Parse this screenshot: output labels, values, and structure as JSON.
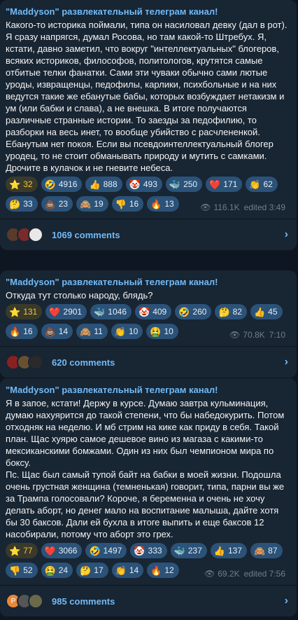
{
  "posts": [
    {
      "channel": "\"Maddyson\" развлекательный телеграм канал!",
      "text": "Какого-то историка поймали, типа он насиловал девку (дал в рот). Я сразу напрягся, думал Росова, но там какой-то Штребух. Я, кстати, давно заметил, что вокруг \"интеллектуальных\" блогеров, всяких историков, философов, политологов, крутятся самые отбитые телки фанатки. Сами эти чуваки обычно сами лютые уроды, извращенцы, педофилы, карлики, психбольные и на них ведутся такие же ебанутые бабы, которых возбуждает нетакизм и ум (или бабки и слава), а не внешка. В итоге получаются различные странные истории. То заезды за педофилию, то разборки на весь инет, то вообще убийство с расчлененкой. Ебанутым нет покоя. Если вы псевдоинтеллектуальный блогер уродец, то не стоит обманывать природу и мутить с самками. Дрочите в кулачок и не гневите небеса.",
      "reactions": [
        {
          "emoji": "⭐",
          "count": "32",
          "paid": true
        },
        {
          "emoji": "🤣",
          "count": "4916"
        },
        {
          "emoji": "👍",
          "count": "888"
        },
        {
          "emoji": "🤡",
          "count": "493"
        },
        {
          "emoji": "🐳",
          "count": "250"
        },
        {
          "emoji": "❤️",
          "count": "171"
        },
        {
          "emoji": "👏",
          "count": "62"
        },
        {
          "emoji": "🤔",
          "count": "33"
        },
        {
          "emoji": "💩",
          "count": "23"
        },
        {
          "emoji": "🙈",
          "count": "19"
        },
        {
          "emoji": "👎",
          "count": "16"
        },
        {
          "emoji": "🔥",
          "count": "13"
        }
      ],
      "views": "116.1K",
      "time": "edited 3:49",
      "comments": "1069 comments",
      "avatars": [
        "#5a3a2a",
        "#7a2a2a",
        "#e8e8e8"
      ]
    },
    {
      "channel": "\"Maddyson\" развлекательный телеграм канал!",
      "text": "Откуда тут столько народу, блядь?",
      "reactions": [
        {
          "emoji": "⭐",
          "count": "131",
          "paid": true
        },
        {
          "emoji": "❤️",
          "count": "2901"
        },
        {
          "emoji": "🐳",
          "count": "1046"
        },
        {
          "emoji": "🤡",
          "count": "409"
        },
        {
          "emoji": "🤣",
          "count": "260"
        },
        {
          "emoji": "🤔",
          "count": "82"
        },
        {
          "emoji": "👍",
          "count": "45"
        },
        {
          "emoji": "🔥",
          "count": "16"
        },
        {
          "emoji": "💩",
          "count": "14"
        },
        {
          "emoji": "🙈",
          "count": "11"
        },
        {
          "emoji": "👏",
          "count": "10"
        },
        {
          "emoji": "🤮",
          "count": "10"
        }
      ],
      "views": "70.8K",
      "time": "7:10",
      "comments": "620 comments",
      "avatars": [
        "#8a2020",
        "#6a5030",
        "#2a2a2a"
      ]
    },
    {
      "channel": "\"Maddyson\" развлекательный телеграм канал!",
      "text": "Я в запое, кстати! Держу в курсе. Думаю завтра кульминация, думаю нахуярится до такой степени, что бы набедокурить. Потом отходняк на неделю. И мб стрим на кике как приду в себя. Такой план. Щас хуярю самое дешевое вино из магаза с какими-то мексиканскими бомжами. Один из них был чемпионом мира по боксу.\nПс. Щас был самый тупой байт на бабки в моей жизни. Подошла очень грустная женщина (темненькая) говорит, типа, парни вы же за Трампа голосовали? Короче, я беременна и очень не хочу делать аборт, но денег мало на воспитание малыша, дайте хотя бы 30 баксов. Дали ей бухла в итоге выпить и еще баксов 12 насобирали, потому что аборт это грех.",
      "reactions": [
        {
          "emoji": "⭐",
          "count": "77",
          "paid": true
        },
        {
          "emoji": "❤️",
          "count": "3066"
        },
        {
          "emoji": "🤣",
          "count": "1497"
        },
        {
          "emoji": "🤡",
          "count": "333"
        },
        {
          "emoji": "🐳",
          "count": "237"
        },
        {
          "emoji": "👍",
          "count": "137"
        },
        {
          "emoji": "🙈",
          "count": "87"
        },
        {
          "emoji": "👎",
          "count": "52"
        },
        {
          "emoji": "🤮",
          "count": "24"
        },
        {
          "emoji": "🤔",
          "count": "17"
        },
        {
          "emoji": "👏",
          "count": "14"
        },
        {
          "emoji": "🔥",
          "count": "12"
        }
      ],
      "views": "69.2K",
      "time": "edited 7:56",
      "comments": "985 comments",
      "avatars": [
        "#e8893a",
        "#555555",
        "#6a6a4a"
      ],
      "first_avatar_letter": "P"
    }
  ],
  "icons": {
    "views": "eye-icon",
    "comments_arrow": "chevron-right-icon"
  },
  "colors": {
    "background": "#0e1621",
    "bubble": "#182533",
    "accent": "#71baf7",
    "reaction_chip": "#2b5278",
    "meta": "#6d7f8f"
  }
}
